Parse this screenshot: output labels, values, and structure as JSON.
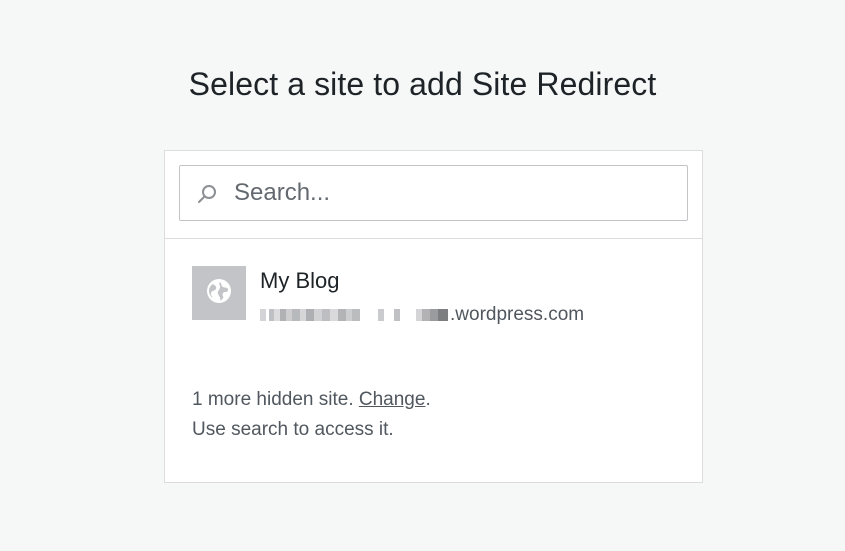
{
  "page": {
    "title": "Select a site to add Site Redirect"
  },
  "search": {
    "placeholder": "Search..."
  },
  "sites": [
    {
      "name": "My Blog",
      "url_suffix": ".wordpress.com",
      "icon": "globe-icon"
    }
  ],
  "hidden_sites": {
    "message_prefix": "1 more hidden site. ",
    "change_link": "Change",
    "message_suffix": ".",
    "hint": "Use search to access it."
  },
  "colors": {
    "background": "#f6f7f7",
    "card": "#ffffff",
    "border": "#dcdcde",
    "site_icon_bg": "#c3c4c7",
    "text_primary": "#1d2327",
    "text_secondary": "#50575e"
  }
}
